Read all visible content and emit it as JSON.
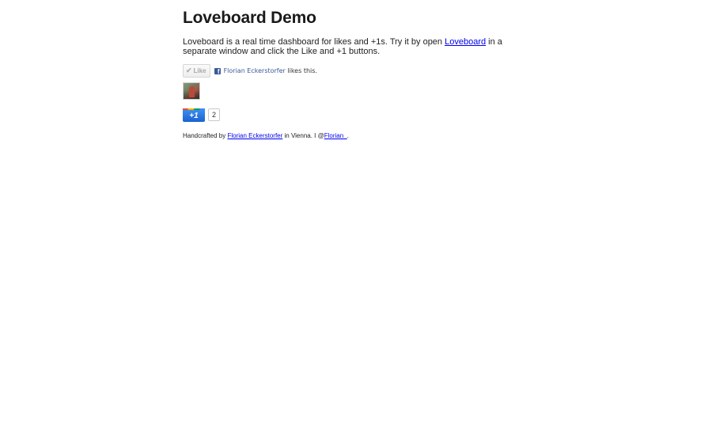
{
  "page": {
    "title": "Loveboard Demo",
    "intro_before": "Loveboard is a real time dashboard for likes and +1s. Try it by open ",
    "intro_link": "Loveboard",
    "intro_after": " in a separate window and click the Like and +1 buttons."
  },
  "facebook": {
    "like_label": "Like",
    "check_icon": "check-icon",
    "fb_icon": "facebook-icon",
    "liker_name": "Florian Eckerstorfer",
    "likes_suffix": " likes this."
  },
  "plusone": {
    "label": "+1",
    "count": "2"
  },
  "footer": {
    "prefix": "Handcrafted by ",
    "author_link": "Florian Eckerstorfer",
    "middle": " in Vienna. I @",
    "twitter_link": "Florian_",
    "suffix": "."
  },
  "colors": {
    "link": "#0000ee",
    "facebook_blue": "#3b5998",
    "plusone_blue": "#1a62d0"
  }
}
